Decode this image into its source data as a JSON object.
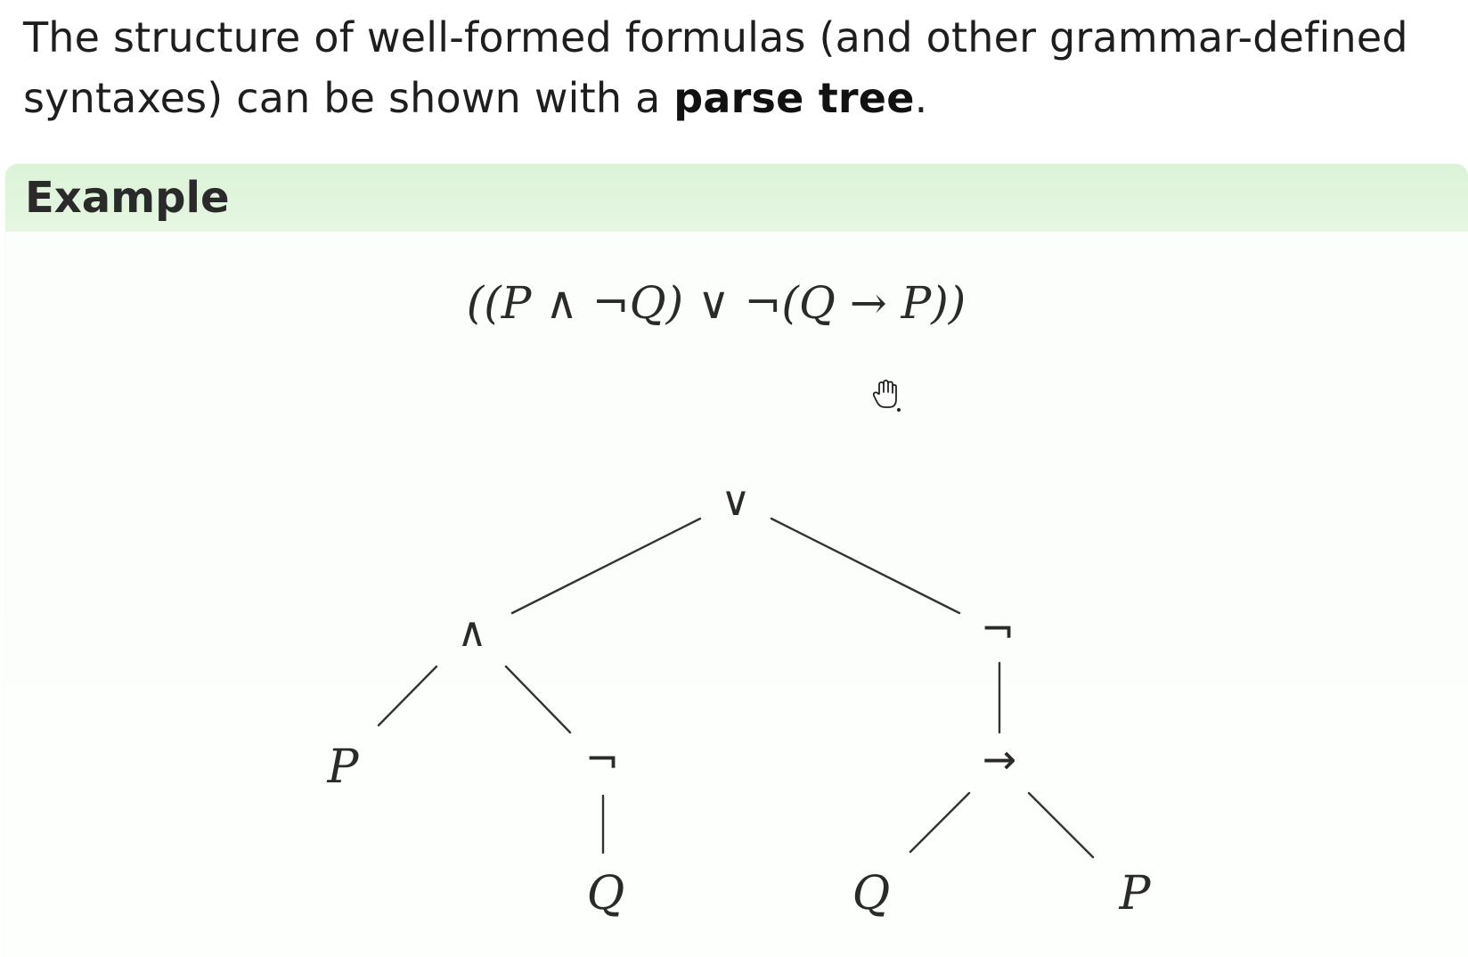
{
  "intro": {
    "before": "The structure of well-formed formulas (and other grammar-defined syntaxes) can be shown with a ",
    "bold": "parse tree",
    "after": "."
  },
  "example": {
    "title": "Example",
    "formula": "((P ∧ ¬Q) ∨ ¬(Q → P))"
  },
  "tree": {
    "nodes": [
      {
        "id": "or",
        "label": "∨",
        "kind": "op"
      },
      {
        "id": "and",
        "label": "∧",
        "kind": "op",
        "parent": "or"
      },
      {
        "id": "not-right",
        "label": "¬",
        "kind": "op",
        "parent": "or"
      },
      {
        "id": "p-left",
        "label": "P",
        "kind": "var",
        "parent": "and"
      },
      {
        "id": "not-left",
        "label": "¬",
        "kind": "op",
        "parent": "and"
      },
      {
        "id": "implies",
        "label": "→",
        "kind": "op",
        "parent": "not-right"
      },
      {
        "id": "q-left",
        "label": "Q",
        "kind": "var",
        "parent": "not-left"
      },
      {
        "id": "q-right",
        "label": "Q",
        "kind": "var",
        "parent": "implies"
      },
      {
        "id": "p-right",
        "label": "P",
        "kind": "var",
        "parent": "implies"
      }
    ]
  },
  "icons": {
    "cursor": "hand-cursor-icon"
  },
  "colors": {
    "header_bg": "#dcf3d8",
    "text": "#1e1e1e"
  }
}
